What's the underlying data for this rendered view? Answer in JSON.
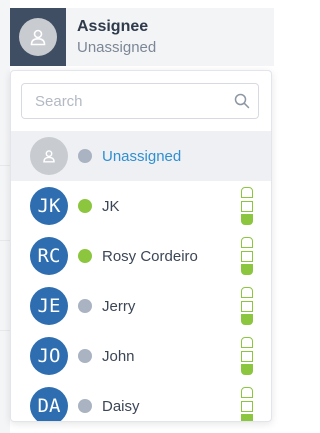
{
  "header": {
    "title": "Assignee",
    "value": "Unassigned"
  },
  "search": {
    "placeholder": "Search",
    "value": ""
  },
  "colors": {
    "status_online": "#8cc63f",
    "status_offline": "#a9b3c2",
    "avatar_bg": "#2d6db0",
    "link": "#2f8fd1"
  },
  "options": [
    {
      "initials": "",
      "name": "Unassigned",
      "status": "offline",
      "selected": true,
      "workload": null
    },
    {
      "initials": "JK",
      "name": "JK",
      "status": "online",
      "selected": false,
      "workload": "1/3"
    },
    {
      "initials": "RC",
      "name": "Rosy Cordeiro",
      "status": "online",
      "selected": false,
      "workload": "1/3"
    },
    {
      "initials": "JE",
      "name": "Jerry",
      "status": "offline",
      "selected": false,
      "workload": "1/3"
    },
    {
      "initials": "JO",
      "name": "John",
      "status": "offline",
      "selected": false,
      "workload": "1/3"
    },
    {
      "initials": "DA",
      "name": "Daisy",
      "status": "offline",
      "selected": false,
      "workload": "1/3"
    }
  ]
}
